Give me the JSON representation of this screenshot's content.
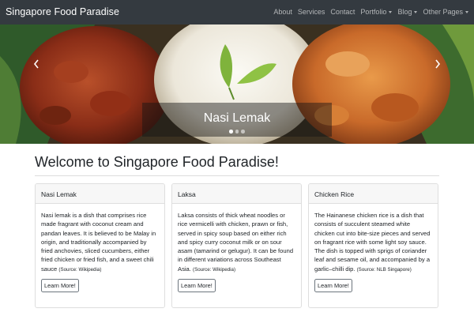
{
  "navbar": {
    "brand": "Singapore Food Paradise",
    "links": [
      {
        "label": "About"
      },
      {
        "label": "Services"
      },
      {
        "label": "Contact"
      },
      {
        "label": "Portfolio",
        "dropdown": true
      },
      {
        "label": "Blog",
        "dropdown": true
      },
      {
        "label": "Other Pages",
        "dropdown": true
      }
    ]
  },
  "carousel": {
    "caption": "Nasi Lemak",
    "slide_count": 3,
    "active_slide": 1,
    "prev_icon": "chevron-left-icon",
    "next_icon": "chevron-right-icon"
  },
  "main": {
    "heading": "Welcome to Singapore Food Paradise!"
  },
  "cards": [
    {
      "title": "Nasi Lemak",
      "text": "Nasi lemak is a dish that comprises rice made fragrant with coconut cream and pandan leaves. It is believed to be Malay in origin, and traditionally accompanied by fried anchovies, sliced cucumbers, either fried chicken or fried fish, and a sweet chili sauce",
      "source": "(Source: Wikipedia)",
      "button": "Learn More!"
    },
    {
      "title": "Laksa",
      "text": "Laksa consists of thick wheat noodles or rice vermicelli with chicken, prawn or fish, served in spicy soup based on either rich and spicy curry coconut milk or on sour asam (tamarind or gelugur). It can be found in different variations across Southeast Asia.",
      "source": "(Source: Wikipedia)",
      "button": "Learn More!"
    },
    {
      "title": "Chicken Rice",
      "text": "The Hainanese chicken rice is a dish that consists of succulent steamed white chicken cut into bite-size pieces and served on fragrant rice with some light soy sauce. The dish is topped with sprigs of coriander leaf and sesame oil, and accompanied by a garlic–chilli dip.",
      "source": "(Source: NLB Singapore)",
      "button": "Learn More!"
    }
  ],
  "colors": {
    "navbar_bg": "#343a40",
    "card_header_bg": "#f7f7f7",
    "button_border": "#6c757d"
  }
}
